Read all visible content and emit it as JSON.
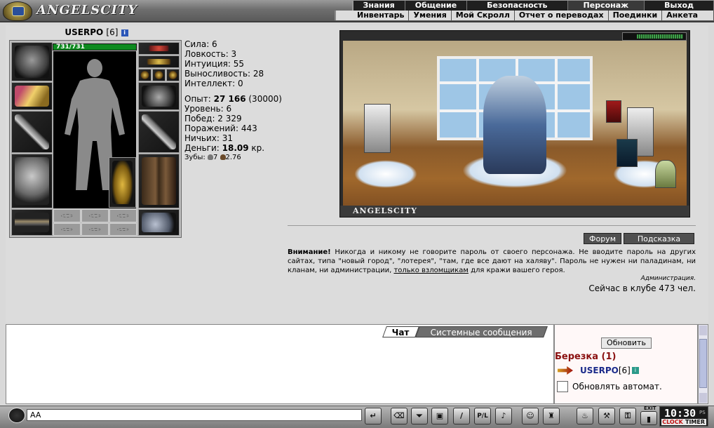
{
  "brand": {
    "name": "ANGELSCITY"
  },
  "menu_primary": [
    "Знания",
    "Общение",
    "Безопасность",
    "Персонаж",
    "Выход"
  ],
  "menu_secondary": [
    "Инвентарь",
    "Умения",
    "Мой Скролл",
    "Отчет о переводах",
    "Поединки",
    "Анкета"
  ],
  "character": {
    "name": "USERPO",
    "level": "[6]",
    "hp": "731/731",
    "hp_fraction": 1.0
  },
  "stats": {
    "strength": "Сила: 6",
    "agility": "Ловкость: 3",
    "intuition": "Интуиция: 55",
    "endurance": "Выносливость: 28",
    "intellect": "Интеллект: 0",
    "exp_label": "Опыт: ",
    "exp_value": "27 166",
    "exp_next": " (30000)",
    "level": "Уровень: 6",
    "wins": "Побед: 2 329",
    "losses": "Поражений: 443",
    "draws": "Ничьих: 31",
    "money_label": "Деньги: ",
    "money_value": "18.09",
    "money_unit": " кр.",
    "teeth_label": "Зубы: ",
    "teeth_a": "7",
    "teeth_b": "2.76"
  },
  "scene": {
    "label": "ANGELSCITY"
  },
  "buttons": {
    "forum": "Форум",
    "hint": "Подсказка",
    "refresh": "Обновить"
  },
  "warning": {
    "bold": "Внимание!",
    "text": " Никогда и никому не говорите пароль от своего персонажа. Не вводите пароль на других сайтах, типа \"новый город\", \"лотерея\", \"там, где все дают на халяву\". Пароль не нужен ни паладинам, ни кланам, ни администрации, ",
    "underlined": "только взломщикам",
    "tail": " для кражи вашего героя.",
    "signature": "Администрация."
  },
  "online": "Сейчас в клубе 473 чел.",
  "chat": {
    "tabs": [
      "Чат",
      "Системные сообщения"
    ],
    "input_value": "AA"
  },
  "room": {
    "name": "Березка (1)",
    "user": "USERPO",
    "user_level": "[6]",
    "auto_refresh": "Обновлять автомат."
  },
  "toolbar": {
    "slash": "/",
    "pl": "P/L",
    "exit": "EXIT"
  },
  "clock": {
    "time": "10:30",
    "suffix": "PS",
    "clock_label": "CLOCK",
    "timer_label": "TIMER"
  }
}
